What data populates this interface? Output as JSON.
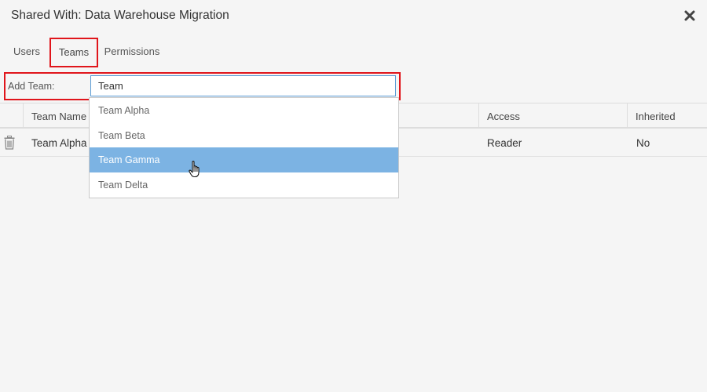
{
  "dialog": {
    "title": "Shared With: Data Warehouse Migration",
    "close_icon": "close-icon"
  },
  "tabs": [
    {
      "label": "Users",
      "active": false
    },
    {
      "label": "Teams",
      "active": true
    },
    {
      "label": "Permissions",
      "active": false
    }
  ],
  "add_team": {
    "label": "Add Team:",
    "value": "Team"
  },
  "table": {
    "columns": [
      "Team Name",
      "Access",
      "Inherited"
    ],
    "rows": [
      {
        "icon": "trash-icon",
        "team_name": "Team Alpha",
        "access": "Reader",
        "inherited": "No"
      }
    ]
  },
  "dropdown": {
    "options": [
      "Team Alpha",
      "Team Beta",
      "Team Gamma",
      "Team Delta"
    ],
    "highlighted": "Team Gamma"
  },
  "colors": {
    "highlight": "#e0151b",
    "option_hover": "#7cb3e3",
    "input_border": "#5b9bd5"
  }
}
